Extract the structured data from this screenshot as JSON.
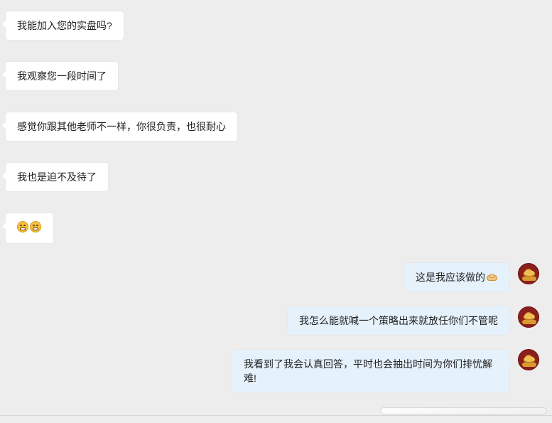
{
  "messages": {
    "m1": "我能加入您的实盘吗?",
    "m2": "我观察您一段时间了",
    "m3": "感觉你跟其他老师不一样，你很负责，也很耐心",
    "m4": "我也是迫不及待了",
    "m5_icon": "grin-icon",
    "m6_text": "这是我应该做的",
    "m6_icon": "handshake-icon",
    "m7": "我怎么能就喊一个策略出来就放任你们不管呢",
    "m8": "我看到了我会认真回答，平时也会抽出时间为你们排忧解难!"
  },
  "colors": {
    "background": "#ededed",
    "incoming_bubble": "#ffffff",
    "outgoing_bubble": "#e5f1fb",
    "avatar": "#8b1f1b",
    "avatar_gold": "#e3a33a"
  }
}
